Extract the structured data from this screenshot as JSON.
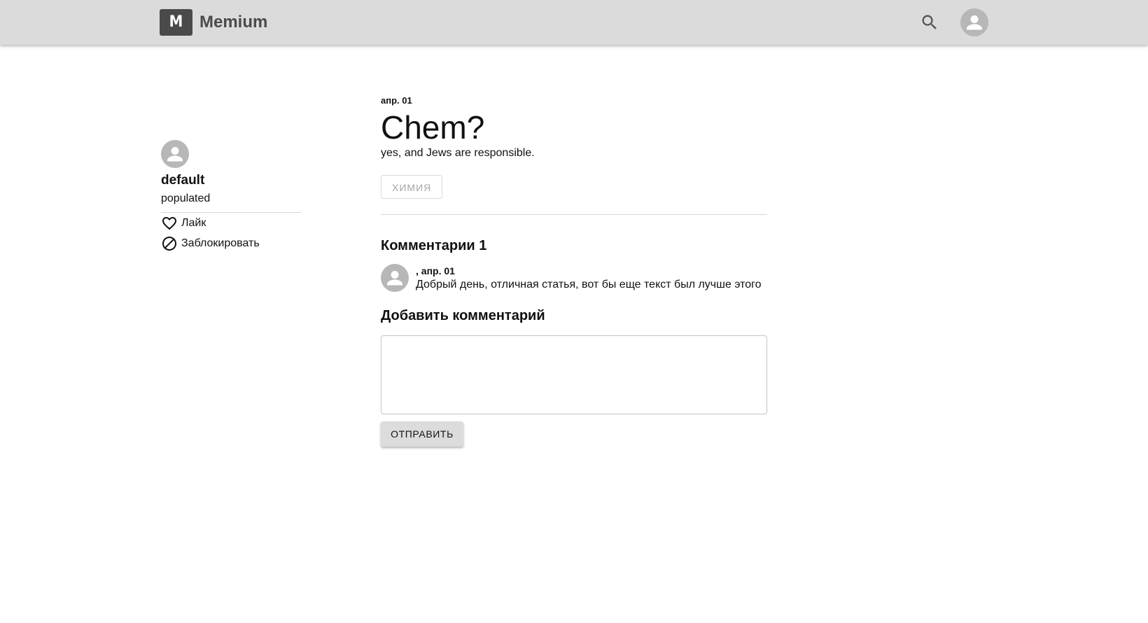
{
  "header": {
    "logo_letter": "M",
    "app_name": "Memium",
    "icons": {
      "search": "search-icon",
      "account": "account-icon"
    }
  },
  "author": {
    "name": "default",
    "bio": "populated",
    "actions": [
      {
        "label": "Лайк",
        "icon": "heart-outline-icon"
      },
      {
        "label": "Заблокировать",
        "icon": "block-icon"
      }
    ]
  },
  "post": {
    "date": "апр. 01",
    "title": "Chem?",
    "subtitle": "yes, and Jews are responsible.",
    "tag": "ХИМИЯ"
  },
  "comments": {
    "heading": "Комментарии 1",
    "items": [
      {
        "meta": ", апр. 01",
        "text": "Добрый день, отличная статья, вот бы еще текст был лучше этого"
      }
    ]
  },
  "add_comment": {
    "heading": "Добавить комментарий",
    "value": "",
    "submit_label": "ОТПРАВИТЬ"
  },
  "colors": {
    "appbar": "#dcdbdc",
    "logo_bg": "#4a4a4a",
    "avatar": "#b7b7b7",
    "tag_text": "#a7a7a7"
  }
}
